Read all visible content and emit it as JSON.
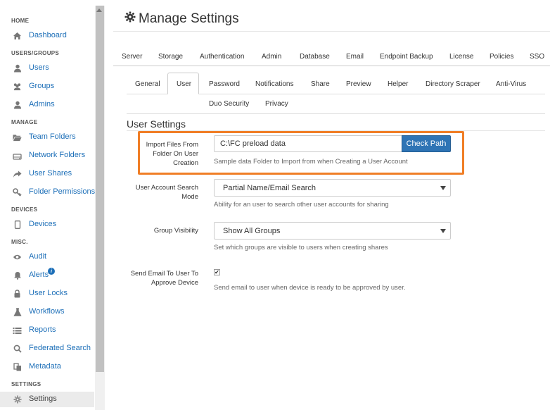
{
  "sidebar": {
    "sections": {
      "home": "HOME",
      "users_groups": "USERS/GROUPS",
      "manage": "MANAGE",
      "devices": "DEVICES",
      "misc": "MISC.",
      "settings": "SETTINGS"
    },
    "items": {
      "dashboard": "Dashboard",
      "users": "Users",
      "groups": "Groups",
      "admins": "Admins",
      "team_folders": "Team Folders",
      "network_folders": "Network Folders",
      "user_shares": "User Shares",
      "folder_permissions": "Folder Permissions",
      "devices": "Devices",
      "audit": "Audit",
      "alerts": "Alerts",
      "user_locks": "User Locks",
      "workflows": "Workflows",
      "reports": "Reports",
      "federated_search": "Federated Search",
      "metadata": "Metadata",
      "settings": "Settings"
    },
    "alerts_badge": "i",
    "link_color": "#1d6fb8"
  },
  "header": {
    "title": "Manage Settings"
  },
  "top_tabs": [
    "Server",
    "Storage",
    "Authentication",
    "Admin",
    "Database",
    "Email",
    "Endpoint Backup",
    "License",
    "Policies",
    "SSO"
  ],
  "sub_tabs": {
    "general": "General",
    "user": "User",
    "password": "Password",
    "notifications": "Notifications",
    "share": "Share",
    "preview": "Preview",
    "helper": "Helper",
    "directory_scraper": "Directory Scraper",
    "anti_virus": "Anti-Virus",
    "duo_security": "Duo Security",
    "privacy": "Privacy"
  },
  "user_settings": {
    "title": "User Settings",
    "import_label_1": "Import Files From",
    "import_label_2": "Folder On User",
    "import_label_3": "Creation",
    "import_value": "C:\\FC preload data",
    "check_path_label": "Check Path",
    "import_help": "Sample data Folder to Import from when Creating a User Account",
    "search_mode_label_1": "User Account Search",
    "search_mode_label_2": "Mode",
    "search_mode_value": "Partial Name/Email Search",
    "search_mode_help": "Ability for an user to search other user accounts for sharing",
    "group_visibility_label": "Group Visibility",
    "group_visibility_value": "Show All Groups",
    "group_visibility_help": "Set which groups are visible to users when creating shares",
    "send_email_label_1": "Send Email To User To",
    "send_email_label_2": "Approve Device",
    "send_email_checked": true,
    "send_email_help": "Send email to user when device is ready to be approved by user."
  },
  "colors": {
    "highlight": "#f07e26",
    "primary_button": "#2e74b5"
  }
}
